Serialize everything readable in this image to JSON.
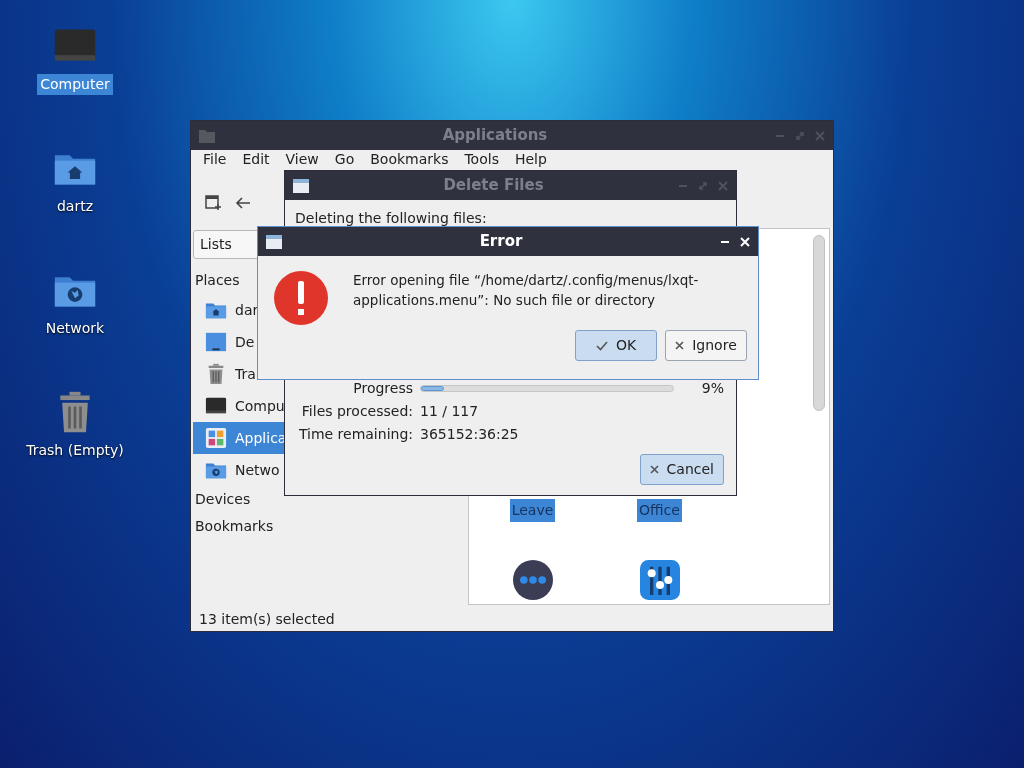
{
  "desktop": {
    "icons": [
      {
        "label": "Computer",
        "kind": "computer",
        "selected": true
      },
      {
        "label": "dartz",
        "kind": "home",
        "selected": false
      },
      {
        "label": "Network",
        "kind": "network",
        "selected": false
      },
      {
        "label": "Trash (Empty)",
        "kind": "trash",
        "selected": false
      }
    ]
  },
  "file_manager": {
    "title": "Applications",
    "menu": [
      "File",
      "Edit",
      "View",
      "Go",
      "Bookmarks",
      "Tools",
      "Help"
    ],
    "side_panel": {
      "mode": "Lists",
      "sections": [
        {
          "label": "Places",
          "items": [
            {
              "label": "dar",
              "kind": "home",
              "selected": false
            },
            {
              "label": "De",
              "kind": "desktop",
              "selected": false
            },
            {
              "label": "Tra",
              "kind": "trash",
              "selected": false
            },
            {
              "label": "Compu",
              "kind": "computer",
              "selected": false
            },
            {
              "label": "Applica",
              "kind": "apps",
              "selected": true
            },
            {
              "label": "Netwo",
              "kind": "network",
              "selected": false
            }
          ]
        },
        {
          "label": "Devices"
        },
        {
          "label": "Bookmarks"
        }
      ]
    },
    "items": [
      {
        "label": "Leave",
        "kind": "leave",
        "selected": true
      },
      {
        "label": "Office",
        "kind": "office",
        "selected": true
      }
    ],
    "status_bar": "13 item(s) selected"
  },
  "delete_dialog": {
    "title": "Delete Files",
    "heading": "Deleting the following files:",
    "progress_label": "Progress",
    "level": 0.09,
    "percent": "9%",
    "rows": [
      {
        "label": "Files processed:",
        "value": "11 / 117"
      },
      {
        "label": "Time remaining:",
        "value": "365152:36:25"
      }
    ],
    "cancel_button": "Cancel"
  },
  "error_dialog": {
    "title": "Error",
    "message": "Error opening file “/home/dartz/.config/menus/lxqt-applications.menu”: No such file or directory",
    "buttons": [
      {
        "label": "OK",
        "kind": "ok",
        "default": true
      },
      {
        "label": "Ignore",
        "kind": "ignore",
        "default": false
      }
    ]
  }
}
